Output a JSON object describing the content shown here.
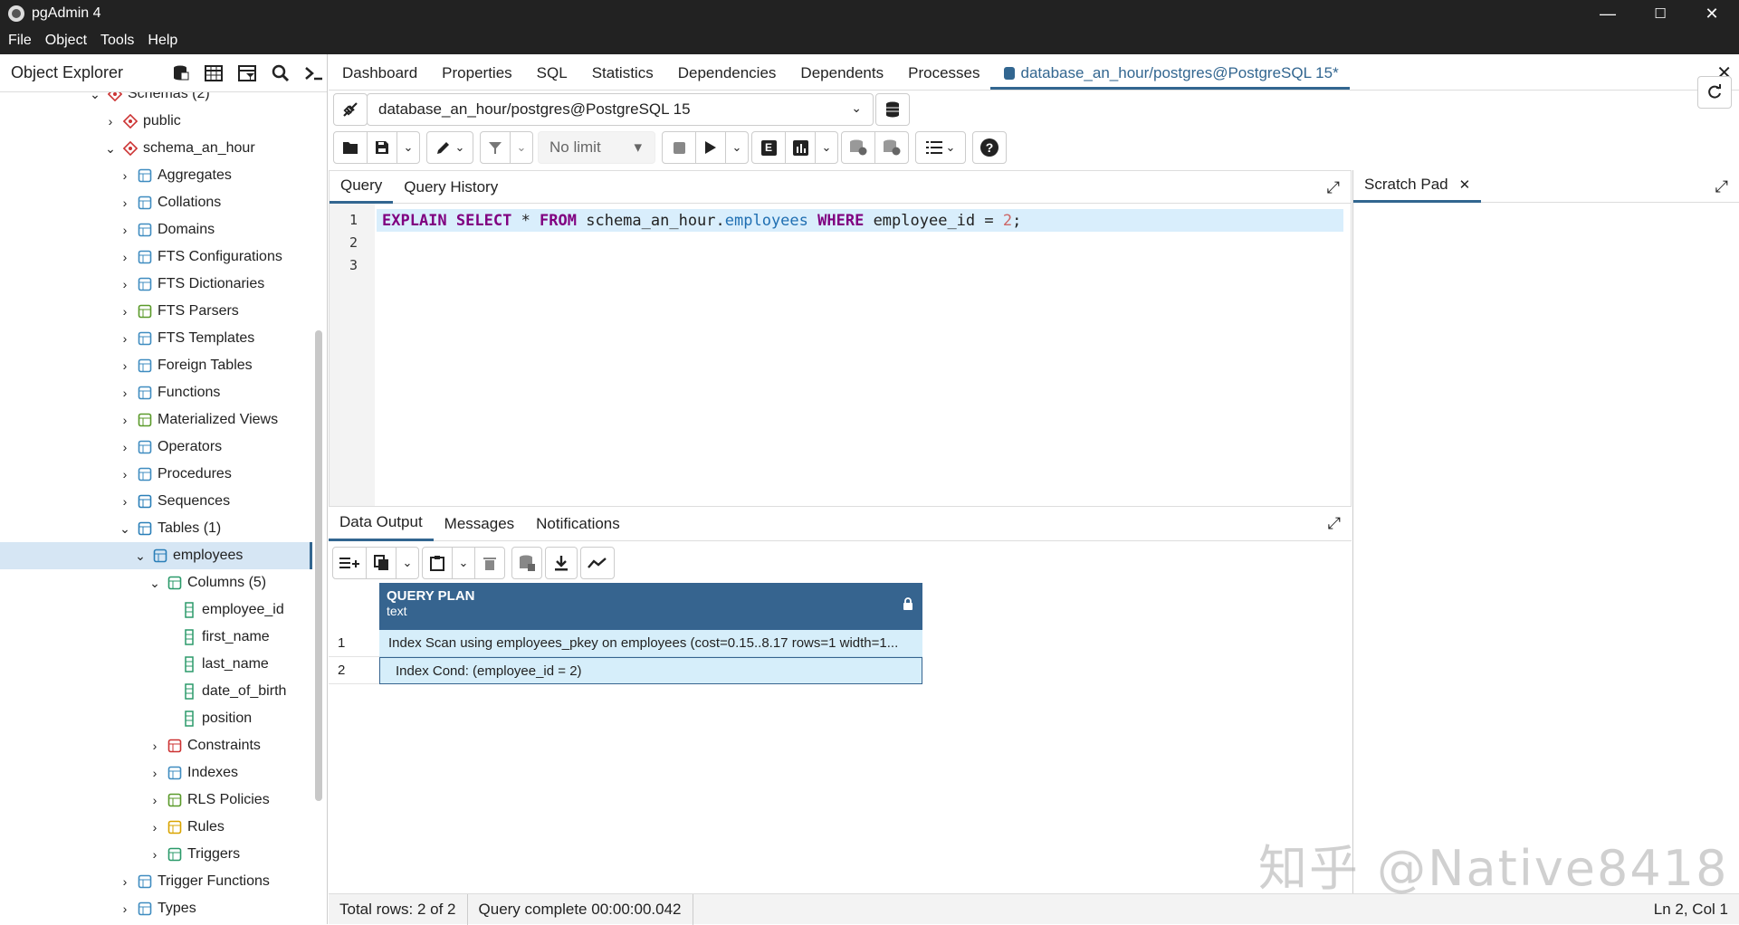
{
  "window": {
    "title": "pgAdmin 4",
    "min": "—",
    "max": "☐",
    "close": "✕"
  },
  "menu": [
    "File",
    "Object",
    "Tools",
    "Help"
  ],
  "explorer": {
    "title": "Object Explorer",
    "nodes": [
      {
        "label": "Schemas (2)",
        "depth": 0,
        "chev": "⌄",
        "icon": "schemas-icon"
      },
      {
        "label": "public",
        "depth": 1,
        "chev": "›",
        "icon": "schema-icon"
      },
      {
        "label": "schema_an_hour",
        "depth": 1,
        "chev": "⌄",
        "icon": "schema-icon"
      },
      {
        "label": "Aggregates",
        "depth": 2,
        "chev": "›",
        "icon": "aggregates-icon"
      },
      {
        "label": "Collations",
        "depth": 2,
        "chev": "›",
        "icon": "collations-icon"
      },
      {
        "label": "Domains",
        "depth": 2,
        "chev": "›",
        "icon": "domains-icon"
      },
      {
        "label": "FTS Configurations",
        "depth": 2,
        "chev": "›",
        "icon": "fts-config-icon"
      },
      {
        "label": "FTS Dictionaries",
        "depth": 2,
        "chev": "›",
        "icon": "fts-dict-icon"
      },
      {
        "label": "FTS Parsers",
        "depth": 2,
        "chev": "›",
        "icon": "fts-parser-icon"
      },
      {
        "label": "FTS Templates",
        "depth": 2,
        "chev": "›",
        "icon": "fts-template-icon"
      },
      {
        "label": "Foreign Tables",
        "depth": 2,
        "chev": "›",
        "icon": "foreign-table-icon"
      },
      {
        "label": "Functions",
        "depth": 2,
        "chev": "›",
        "icon": "functions-icon"
      },
      {
        "label": "Materialized Views",
        "depth": 2,
        "chev": "›",
        "icon": "mview-icon"
      },
      {
        "label": "Operators",
        "depth": 2,
        "chev": "›",
        "icon": "operators-icon"
      },
      {
        "label": "Procedures",
        "depth": 2,
        "chev": "›",
        "icon": "procedures-icon"
      },
      {
        "label": "Sequences",
        "depth": 2,
        "chev": "›",
        "icon": "sequences-icon"
      },
      {
        "label": "Tables (1)",
        "depth": 2,
        "chev": "⌄",
        "icon": "tables-icon"
      },
      {
        "label": "employees",
        "depth": 3,
        "chev": "⌄",
        "icon": "table-icon",
        "selected": true
      },
      {
        "label": "Columns (5)",
        "depth": 4,
        "chev": "⌄",
        "icon": "columns-icon"
      },
      {
        "label": "employee_id",
        "depth": 5,
        "chev": "",
        "icon": "column-icon"
      },
      {
        "label": "first_name",
        "depth": 5,
        "chev": "",
        "icon": "column-icon"
      },
      {
        "label": "last_name",
        "depth": 5,
        "chev": "",
        "icon": "column-icon"
      },
      {
        "label": "date_of_birth",
        "depth": 5,
        "chev": "",
        "icon": "column-icon"
      },
      {
        "label": "position",
        "depth": 5,
        "chev": "",
        "icon": "column-icon"
      },
      {
        "label": "Constraints",
        "depth": 4,
        "chev": "›",
        "icon": "constraints-icon"
      },
      {
        "label": "Indexes",
        "depth": 4,
        "chev": "›",
        "icon": "indexes-icon"
      },
      {
        "label": "RLS Policies",
        "depth": 4,
        "chev": "›",
        "icon": "rls-icon"
      },
      {
        "label": "Rules",
        "depth": 4,
        "chev": "›",
        "icon": "rules-icon"
      },
      {
        "label": "Triggers",
        "depth": 4,
        "chev": "›",
        "icon": "triggers-icon"
      },
      {
        "label": "Trigger Functions",
        "depth": 2,
        "chev": "›",
        "icon": "trigger-functions-icon"
      },
      {
        "label": "Types",
        "depth": 2,
        "chev": "›",
        "icon": "types-icon"
      }
    ]
  },
  "tabs": [
    "Dashboard",
    "Properties",
    "SQL",
    "Statistics",
    "Dependencies",
    "Dependents",
    "Processes",
    "database_an_hour/postgres@PostgreSQL 15*"
  ],
  "connection": "database_an_hour/postgres@PostgreSQL 15",
  "limit": "No limit",
  "query_tabs": [
    "Query",
    "Query History"
  ],
  "scratch_pad": "Scratch Pad",
  "code": {
    "line_numbers": [
      "1",
      "2",
      "3"
    ],
    "t1": "EXPLAIN",
    "t2": " ",
    "t3": "SELECT",
    "t4": " * ",
    "t5": "FROM",
    "t6": " schema_an_hour.",
    "t7": "employees",
    "t8": " ",
    "t9": "WHERE",
    "t10": " employee_id = ",
    "t11": "2",
    "t12": ";"
  },
  "output_tabs": [
    "Data Output",
    "Messages",
    "Notifications"
  ],
  "grid": {
    "column": "QUERY PLAN",
    "type": "text",
    "rows": [
      {
        "no": "1",
        "value": "Index Scan using employees_pkey on employees  (cost=0.15..8.17 rows=1 width=1..."
      },
      {
        "no": "2",
        "value": "Index Cond: (employee_id = 2)"
      }
    ]
  },
  "status": {
    "rows": "Total rows: 2 of 2",
    "time": "Query complete 00:00:00.042",
    "pos": "Ln 2, Col 1"
  },
  "watermark": "知乎 @Native8418"
}
